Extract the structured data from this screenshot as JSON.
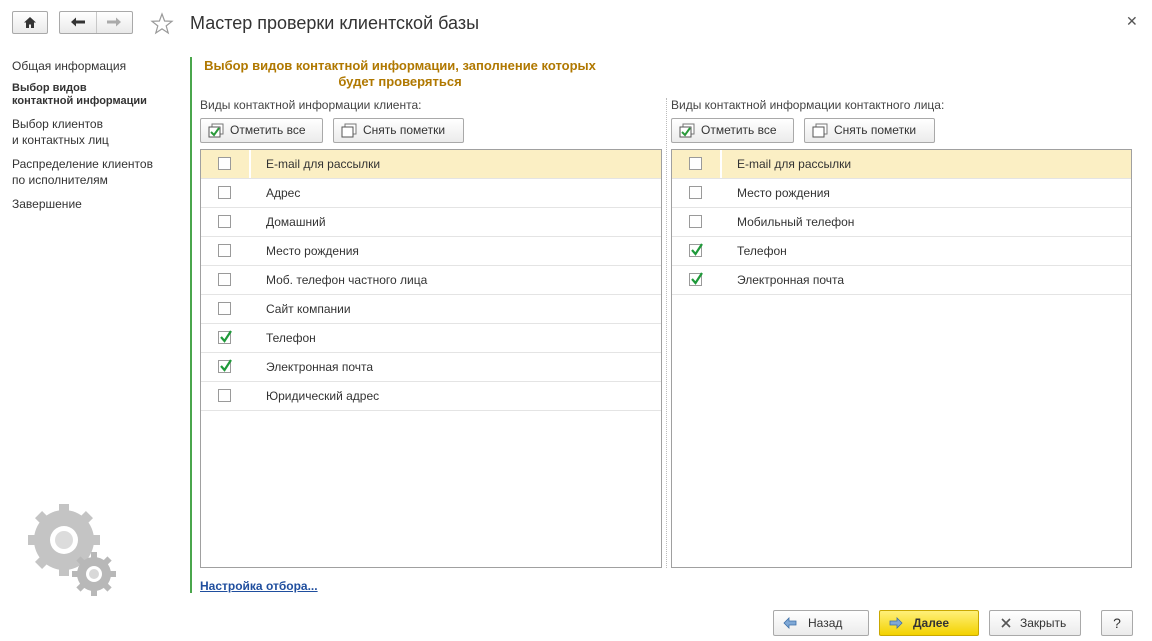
{
  "window": {
    "title": "Мастер проверки клиентской базы"
  },
  "header_icons": {
    "home": "home-icon",
    "back": "arrow-left-icon",
    "forward": "arrow-right-icon",
    "favorite": "star-icon",
    "close": "close-icon"
  },
  "steps": [
    {
      "label": "Общая информация",
      "active": false
    },
    {
      "label": "Выбор видов\nконтактной информации",
      "active": true
    },
    {
      "label": "Выбор клиентов\nи контактных лиц",
      "active": false
    },
    {
      "label": "Распределение клиентов\nпо исполнителям",
      "active": false
    },
    {
      "label": "Завершение",
      "active": false
    }
  ],
  "heading": "Выбор видов контактной информации, заполнение которых будет проверяться",
  "left_panel": {
    "label": "Виды контактной информации клиента:",
    "check_all": "Отметить все",
    "uncheck_all": "Снять пометки",
    "items": [
      {
        "name": "E-mail для рассылки",
        "checked": false,
        "selected": true
      },
      {
        "name": "Адрес",
        "checked": false
      },
      {
        "name": "Домашний",
        "checked": false
      },
      {
        "name": "Место рождения",
        "checked": false
      },
      {
        "name": "Моб. телефон частного лица",
        "checked": false
      },
      {
        "name": "Сайт компании",
        "checked": false
      },
      {
        "name": "Телефон",
        "checked": true
      },
      {
        "name": "Электронная почта",
        "checked": true
      },
      {
        "name": "Юридический адрес",
        "checked": false
      }
    ]
  },
  "right_panel": {
    "label": "Виды контактной информации контактного лица:",
    "check_all": "Отметить все",
    "uncheck_all": "Снять пометки",
    "items": [
      {
        "name": "E-mail для рассылки",
        "checked": false,
        "selected": true
      },
      {
        "name": "Место рождения",
        "checked": false
      },
      {
        "name": "Мобильный телефон",
        "checked": false
      },
      {
        "name": "Телефон",
        "checked": true
      },
      {
        "name": "Электронная почта",
        "checked": true
      }
    ]
  },
  "filter_link": "Настройка отбора...",
  "buttons": {
    "back": "Назад",
    "next": "Далее",
    "close": "Закрыть",
    "help": "?"
  },
  "colors": {
    "accent_green": "#4aa64c",
    "heading": "#b07800",
    "selected_row": "#fbefc4",
    "primary_button": "#f3d200",
    "link": "#1f4e9e"
  }
}
